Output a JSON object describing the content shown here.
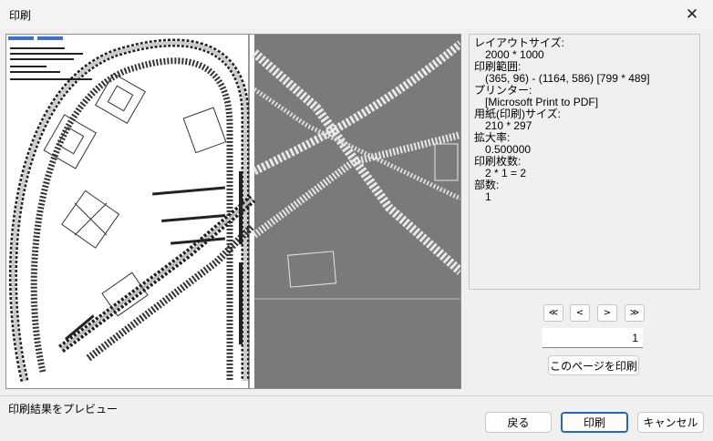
{
  "window": {
    "title": "印刷"
  },
  "print_info": {
    "layout_size_label": "レイアウトサイズ:",
    "layout_size_value": "2000 * 1000",
    "print_range_label": "印刷範囲:",
    "print_range_value": "(365, 96) - (1164, 586) [799 * 489]",
    "printer_label": "プリンター:",
    "printer_value": "[Microsoft Print to PDF]",
    "paper_label": "用紙(印刷)サイズ:",
    "paper_value": "210 * 297",
    "scale_label": "拡大率:",
    "scale_value": "0.500000",
    "page_count_label": "印刷枚数:",
    "page_count_value": "2 * 1 = 2",
    "copies_label": "部数:",
    "copies_value": "1"
  },
  "navigation": {
    "first_label": "≪",
    "prev_label": "<",
    "next_label": ">",
    "last_label": "≫",
    "page_value": "1",
    "print_page_label": "このページを印刷"
  },
  "status_text": "印刷結果をプレビュー",
  "footer": {
    "back_label": "戻る",
    "print_label": "印刷",
    "cancel_label": "キャンセル"
  },
  "colors": {
    "accent": "#2067c9",
    "preview_gray": "#7a7a7a"
  }
}
